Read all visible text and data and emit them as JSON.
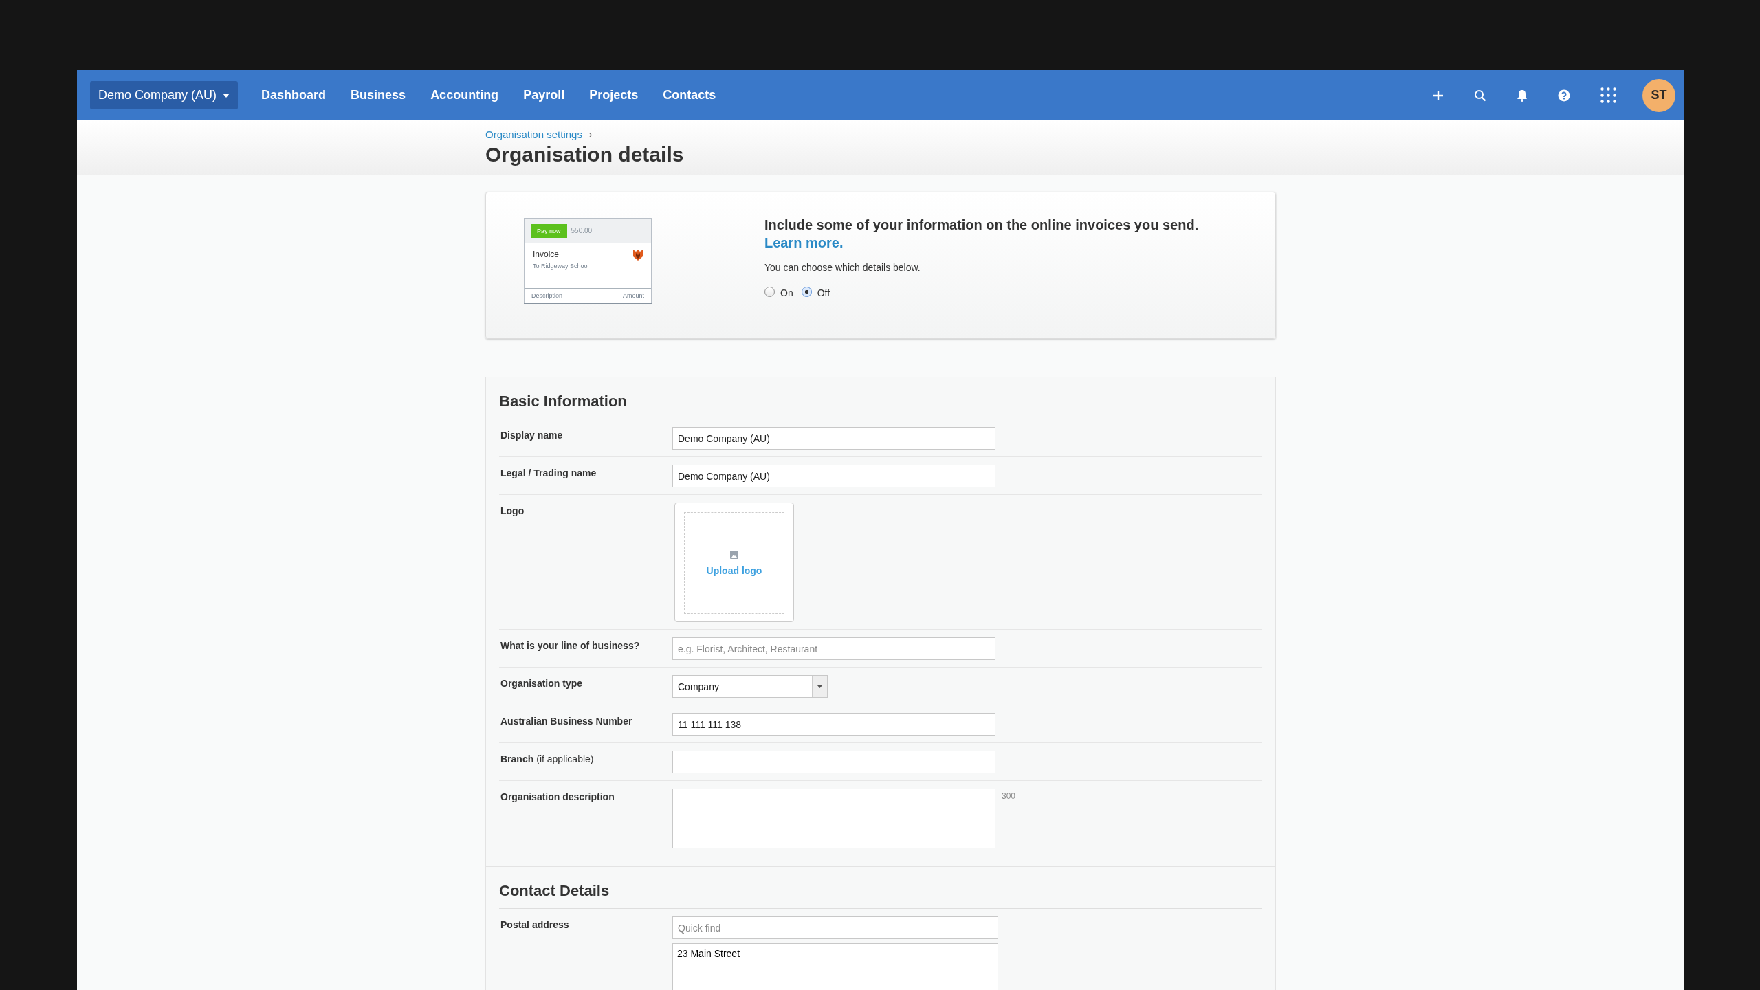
{
  "topbar": {
    "organisation": "Demo Company (AU)",
    "nav": [
      {
        "label": "Dashboard"
      },
      {
        "label": "Business"
      },
      {
        "label": "Accounting"
      },
      {
        "label": "Payroll"
      },
      {
        "label": "Projects"
      },
      {
        "label": "Contacts"
      }
    ],
    "avatar": "ST"
  },
  "header": {
    "breadcrumb": "Organisation settings",
    "breadcrumb_separator": "›",
    "title": "Organisation details"
  },
  "banner": {
    "preview": {
      "pay_button": "Pay now",
      "amount": "550.00",
      "heading": "Invoice",
      "recipient": "To Ridgeway School",
      "column_1": "Description",
      "column_2": "Amount"
    },
    "headline": "Include some of your information on the online invoices you send.",
    "link": "Learn more.",
    "hint": "You can choose which details below.",
    "options": [
      {
        "label": "On",
        "selected": false
      },
      {
        "label": "Off",
        "selected": true
      }
    ]
  },
  "sections": [
    {
      "title": "Basic Information",
      "fields": [
        {
          "kind": "text",
          "label": "Display name",
          "value": "Demo Company (AU)"
        },
        {
          "kind": "text",
          "label": "Legal / Trading name",
          "value": "Demo Company (AU)"
        },
        {
          "kind": "logo",
          "label": "Logo",
          "action": "Upload logo"
        },
        {
          "kind": "text",
          "label": "What is your line of business?",
          "placeholder": "e.g. Florist, Architect, Restaurant"
        },
        {
          "kind": "select",
          "label": "Organisation type",
          "value": "Company"
        },
        {
          "kind": "text",
          "label": "Australian Business Number",
          "value": "11 111 111 138"
        },
        {
          "kind": "text",
          "label": "Branch",
          "note": "(if applicable)"
        },
        {
          "kind": "textarea",
          "label": "Organisation description",
          "counter": "300"
        }
      ]
    },
    {
      "title": "Contact Details",
      "fields": [
        {
          "kind": "address",
          "label": "Postal address",
          "placeholder": "Quick find",
          "value": "23 Main Street"
        }
      ]
    }
  ]
}
